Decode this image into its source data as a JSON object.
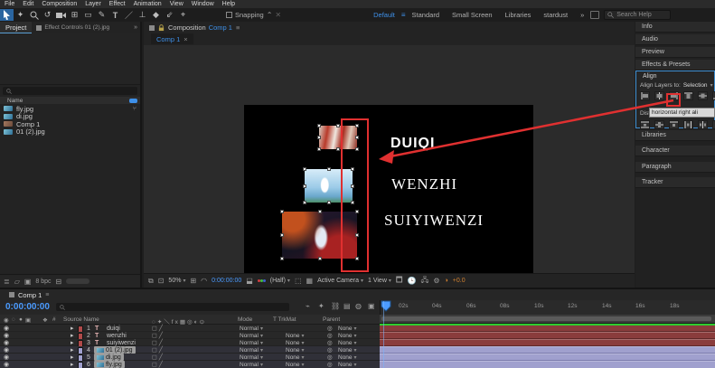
{
  "menu": {
    "items": [
      "File",
      "Edit",
      "Composition",
      "Layer",
      "Effect",
      "Animation",
      "View",
      "Window",
      "Help"
    ]
  },
  "toolbar": {
    "tools": [
      "selection-tool",
      "hand-tool",
      "zoom-tool",
      "rotation-tool",
      "camera-tool",
      "pan-behind-tool",
      "shape-tool",
      "pen-tool",
      "type-tool",
      "brush-tool",
      "clone-stamp-tool",
      "eraser-tool",
      "roto-brush-tool",
      "puppet-pin-tool"
    ],
    "snapping_label": "Snapping",
    "workspaces": [
      "Default",
      "Standard",
      "Small Screen",
      "Libraries",
      "stardust"
    ],
    "overflow": "»",
    "search_placeholder": "Search Help"
  },
  "project": {
    "tab": "Project",
    "effect_controls_tab": "Effect Controls 01 (2).jpg",
    "name_header": "Name",
    "items": [
      {
        "name": "fly.jpg"
      },
      {
        "name": "di.jpg"
      },
      {
        "name": "Comp 1"
      },
      {
        "name": "01 (2).jpg"
      }
    ],
    "bpc": "8 bpc"
  },
  "composition": {
    "panel_tab_prefix": "Composition",
    "panel_tab_name": "Comp 1",
    "viewer_tab": "Comp 1",
    "canvas_texts": [
      "DUIQI",
      "WENZHI",
      "SUIYIWENZI"
    ],
    "zoom": "50%",
    "timecode": "0:00:00:00",
    "resolution": "(Half)",
    "camera": "Active Camera",
    "view": "1 View",
    "exposure": "+0.0"
  },
  "right_panel": {
    "collapsed_top": [
      "Info",
      "Audio",
      "Preview",
      "Effects & Presets"
    ],
    "align": {
      "title": "Align",
      "layers_to_label": "Align Layers to:",
      "layers_to_value": "Selection",
      "distribute_label": "Distribute:",
      "tooltip": "horizontal right ali"
    },
    "collapsed_bottom": [
      "Libraries",
      "Character",
      "Paragraph",
      "Tracker"
    ]
  },
  "timeline": {
    "tab": "Comp 1",
    "timecode": "0:00:00:00",
    "columns": {
      "source_name": "Source Name",
      "mode": "Mode",
      "trkmat": "T TrkMat",
      "parent": "Parent"
    },
    "mode_value": "Normal",
    "layers": [
      {
        "num": "1",
        "type": "T",
        "name": "duiqi",
        "mode": "Normal",
        "trkmat": "",
        "parent": "None",
        "selected": false
      },
      {
        "num": "2",
        "type": "T",
        "name": "wenzhi",
        "mode": "Normal",
        "trkmat": "None",
        "parent": "None",
        "selected": false
      },
      {
        "num": "3",
        "type": "T",
        "name": "suiyiwenzi",
        "mode": "Normal",
        "trkmat": "None",
        "parent": "None",
        "selected": false
      },
      {
        "num": "4",
        "type": "img",
        "name": "01 (2).jpg",
        "mode": "Normal",
        "trkmat": "None",
        "parent": "None",
        "selected": true
      },
      {
        "num": "5",
        "type": "img",
        "name": "di.jpg",
        "mode": "Normal",
        "trkmat": "None",
        "parent": "None",
        "selected": true
      },
      {
        "num": "6",
        "type": "img",
        "name": "fly.jpg",
        "mode": "Normal",
        "trkmat": "None",
        "parent": "None",
        "selected": true
      }
    ],
    "ruler_labels": [
      "02s",
      "04s",
      "06s",
      "08s",
      "10s",
      "12s",
      "14s",
      "16s",
      "18s"
    ]
  },
  "colors": {
    "accent_blue": "#3e90e8",
    "annotation_red": "#e03030",
    "label_red": "#b04a4a",
    "label_lavender": "#a0a0ce",
    "workarea_green": "#2ecc2e",
    "tooltip_bg": "#d9d9d9"
  }
}
